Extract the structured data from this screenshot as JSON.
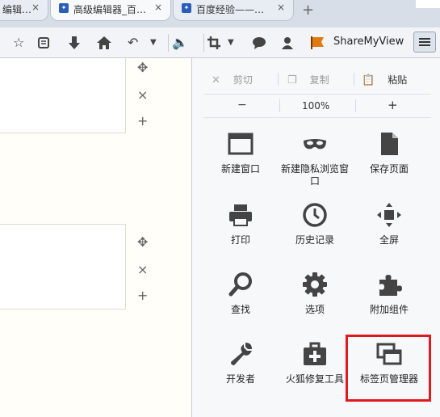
{
  "tabs": [
    {
      "label": "编辑…",
      "close": "×"
    },
    {
      "label": "高级编辑器_百…",
      "close": "×"
    },
    {
      "label": "百度经验——…",
      "close": "×"
    }
  ],
  "new_tab": "+",
  "toolbar": {
    "sharemyview_label": "ShareMyView"
  },
  "page": {
    "controls": {
      "move": "✥",
      "remove": "×",
      "add": "+"
    }
  },
  "menu": {
    "edit": {
      "cut": "剪切",
      "copy": "复制",
      "paste": "粘贴"
    },
    "zoom": {
      "out": "−",
      "level": "100%",
      "in": "+"
    },
    "items": [
      {
        "label": "新建窗口",
        "icon": "window-icon"
      },
      {
        "label": "新建隐私浏览窗口",
        "icon": "private-mask-icon"
      },
      {
        "label": "保存页面",
        "icon": "save-page-icon"
      },
      {
        "label": "打印",
        "icon": "printer-icon"
      },
      {
        "label": "历史记录",
        "icon": "history-clock-icon"
      },
      {
        "label": "全屏",
        "icon": "fullscreen-icon"
      },
      {
        "label": "查找",
        "icon": "magnifier-icon"
      },
      {
        "label": "选项",
        "icon": "gear-icon"
      },
      {
        "label": "附加组件",
        "icon": "puzzle-icon"
      },
      {
        "label": "开发者",
        "icon": "wrench-icon"
      },
      {
        "label": "火狐修复工具",
        "icon": "repair-kit-icon"
      },
      {
        "label": "标签页管理器",
        "icon": "tab-manager-icon"
      }
    ]
  },
  "highlight_color": "#e0191f"
}
